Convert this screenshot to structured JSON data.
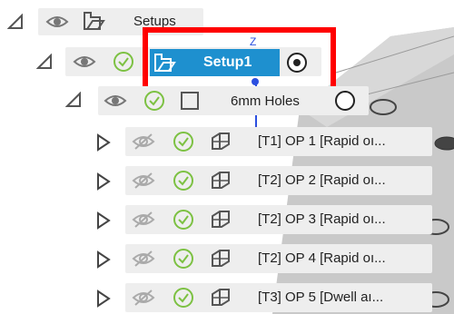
{
  "tree": {
    "root": {
      "label": "Setups"
    },
    "setup": {
      "label": "Setup1",
      "selected": true
    },
    "folder": {
      "label": "6mm Holes"
    },
    "operations": [
      {
        "label": "[T1] OP 1 [Rapid oı...",
        "icon": "toolpath-icon"
      },
      {
        "label": "[T2] OP 2 [Rapid oı...",
        "icon": "toolpath-icon"
      },
      {
        "label": "[T2] OP 3 [Rapid oı...",
        "icon": "toolpath-icon"
      },
      {
        "label": "[T2] OP 4 [Rapid oı...",
        "icon": "toolpath-icon"
      },
      {
        "label": "[T3] OP 5 [Dwell aı...",
        "icon": "toolpath-icon"
      }
    ]
  },
  "colors": {
    "selection": "#1e90cf",
    "highlight_box": "#ff0000",
    "check": "#7cc142",
    "model": "#c9c9c9"
  }
}
